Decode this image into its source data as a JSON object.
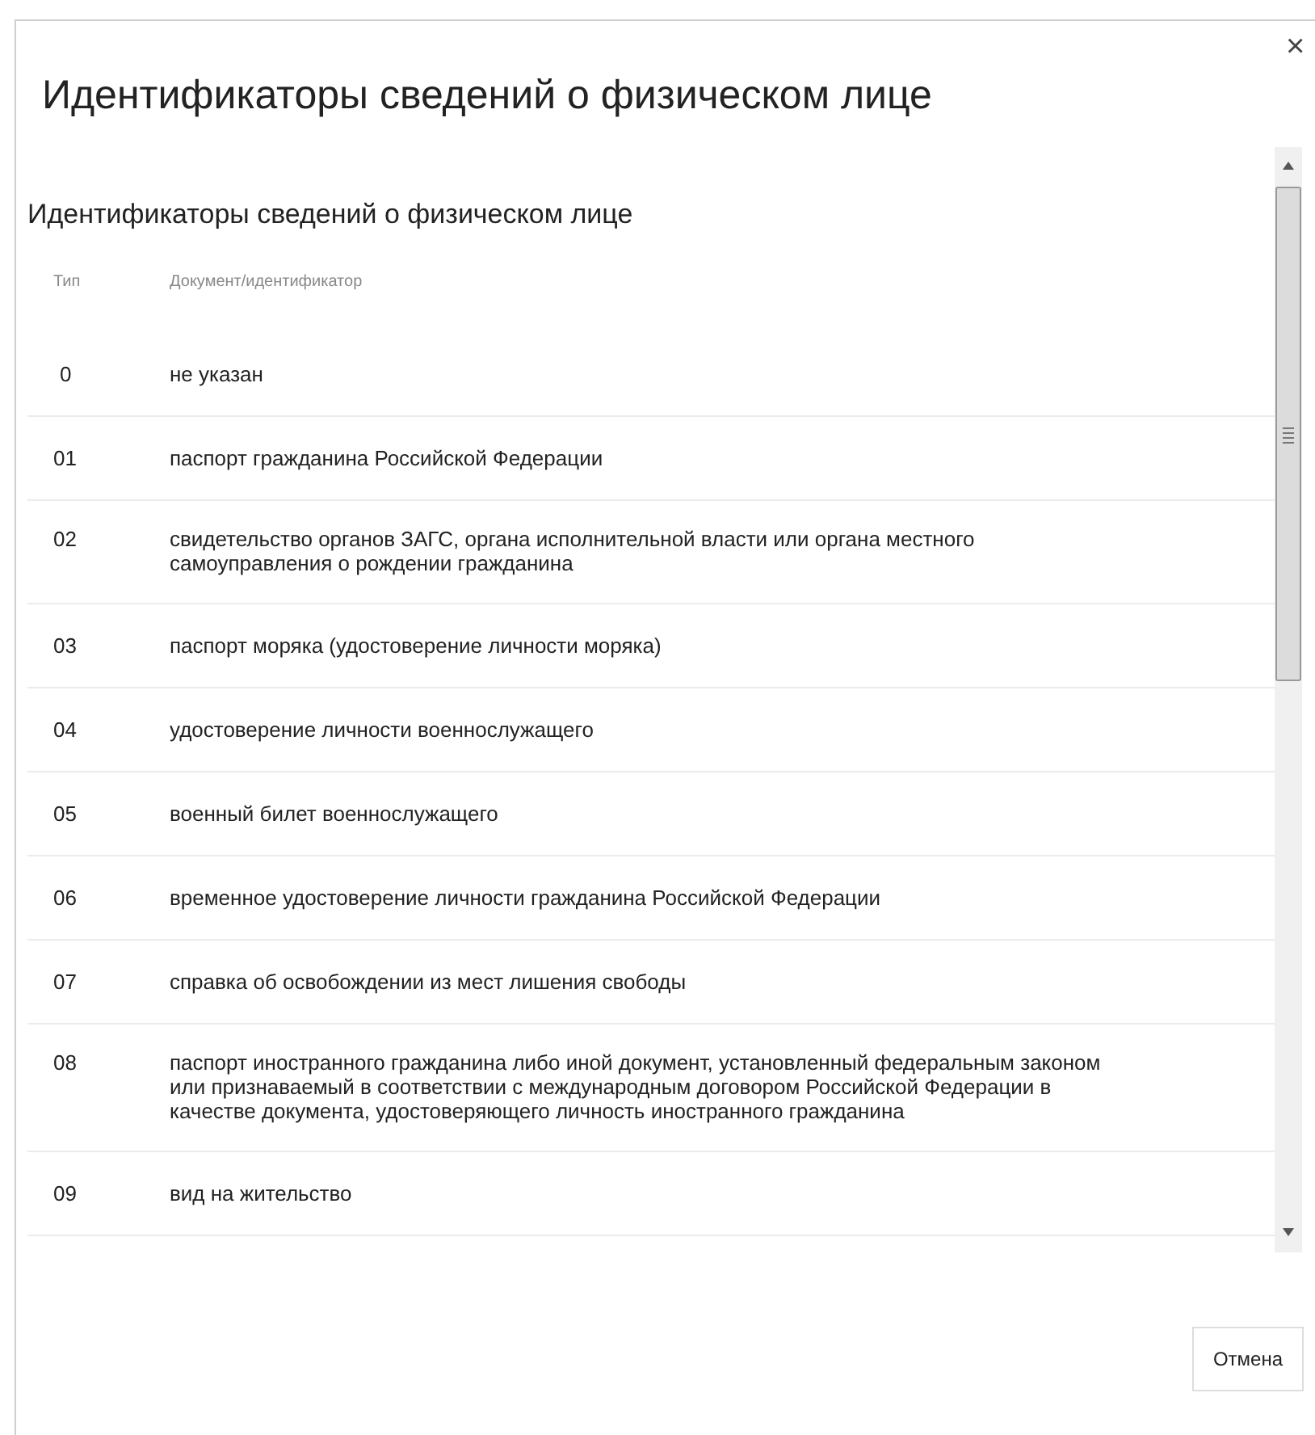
{
  "dialog": {
    "title": "Идентификаторы сведений о физическом лице",
    "close": "×"
  },
  "section_title": "Идентификаторы сведений о физическом лице",
  "table": {
    "columns": [
      "Тип",
      "Документ/идентификатор"
    ],
    "rows": [
      {
        "code": "0",
        "name": "не указан"
      },
      {
        "code": "01",
        "name": "паспорт гражданина Российской Федерации"
      },
      {
        "code": "02",
        "name": "свидетельство органов ЗАГС, органа исполнительной власти или органа местного самоуправления о рождении гражданина"
      },
      {
        "code": "03",
        "name": "паспорт моряка (удостоверение личности моряка)"
      },
      {
        "code": "04",
        "name": "удостоверение личности военнослужащего"
      },
      {
        "code": "05",
        "name": "военный билет военнослужащего"
      },
      {
        "code": "06",
        "name": "временное удостоверение личности гражданина Российской Федерации"
      },
      {
        "code": "07",
        "name": "справка об освобождении из мест лишения свободы"
      },
      {
        "code": "08",
        "name": "паспорт иностранного гражданина либо иной документ, установленный федеральным законом или признаваемый в соответствии с международным договором Российской Федерации в качестве документа, удостоверяющего личность иностранного гражданина"
      },
      {
        "code": "09",
        "name": "вид на жительство"
      }
    ]
  },
  "buttons": [
    "Отмена"
  ]
}
